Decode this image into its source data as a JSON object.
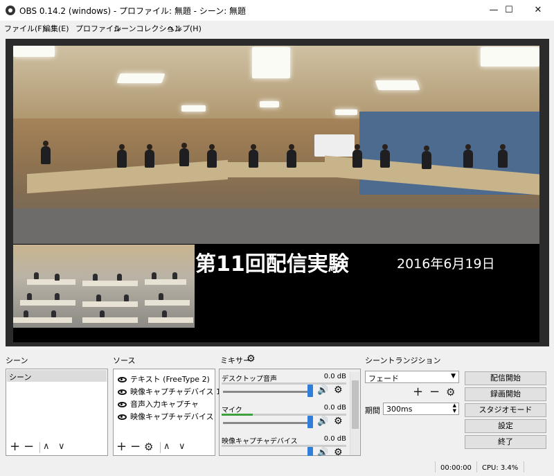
{
  "window": {
    "title": "OBS 0.14.2 (windows) - プロファイル: 無題 - シーン: 無題",
    "minimize": "—",
    "maximize": "☐",
    "close": "✕"
  },
  "menu": [
    "ファイル(F)",
    "編集(E)",
    "プロファイル",
    "シーンコレクション",
    "ヘルプ(H)"
  ],
  "preview": {
    "overlay_title": "第11回配信実験",
    "overlay_date": "2016年6月19日"
  },
  "scenes": {
    "label": "シーン",
    "items": [
      "シーン"
    ],
    "add": "+",
    "remove": "−",
    "up": "∧",
    "down": "∨"
  },
  "sources": {
    "label": "ソース",
    "items": [
      "テキスト (FreeType 2)",
      "映像キャプチャデバイス 1",
      "音声入力キャプチャ",
      "映像キャプチャデバイス"
    ],
    "add": "+",
    "remove": "−",
    "settings": "⚙",
    "up": "∧",
    "down": "∨"
  },
  "mixer": {
    "label": "ミキサー",
    "channels": [
      {
        "name": "デスクトップ音声",
        "db": "0.0 dB",
        "level": 0.0
      },
      {
        "name": "マイク",
        "db": "0.0 dB",
        "level": 0.25
      },
      {
        "name": "映像キャプチャデバイス",
        "db": "0.0 dB",
        "level": 0.0
      }
    ]
  },
  "transition": {
    "label": "シーントランジション",
    "selected": "フェード",
    "add": "+",
    "remove": "−",
    "settings": "⚙",
    "duration_label": "期間",
    "duration": "300ms"
  },
  "controls": [
    "配信開始",
    "録画開始",
    "スタジオモード",
    "設定",
    "終了"
  ],
  "status": {
    "time": "00:00:00",
    "cpu": "CPU: 3.4%"
  },
  "colors": {
    "accent": "#2f7fd8",
    "meter_green": "#3fa03f"
  }
}
